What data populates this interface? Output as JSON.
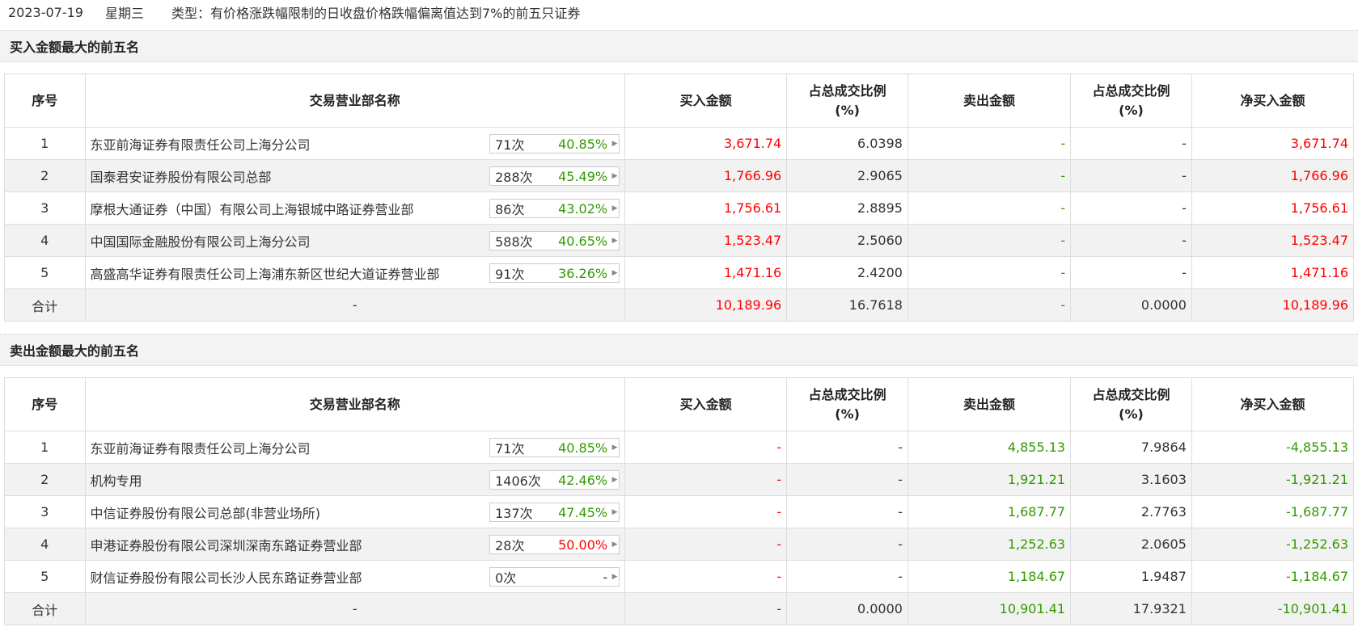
{
  "header": {
    "date": "2023-07-19",
    "weekday": "星期三",
    "type_text": "类型：有价格涨跌幅限制的日收盘价格跌幅偏离值达到7%的前五只证券"
  },
  "columns": {
    "idx": "序号",
    "name": "交易营业部名称",
    "buy": "买入金额",
    "buy_ratio_1": "占总成交比例",
    "buy_ratio_2": "(%)",
    "sell": "卖出金额",
    "sell_ratio_1": "占总成交比例",
    "sell_ratio_2": "(%)",
    "net": "净买入金额"
  },
  "colors": {
    "up": "#ff0000",
    "down": "#339900",
    "neutral": "#333333"
  },
  "buy_section": {
    "title": "买入金额最大的前五名",
    "rows": [
      {
        "idx": "1",
        "name": "东亚前海证券有限责任公司上海分公司",
        "count": "71次",
        "rate": "40.85%",
        "buy": "3,671.74",
        "buy_ratio": "6.0398",
        "sell": "-",
        "sell_ratio": "-",
        "net": "3,671.74"
      },
      {
        "idx": "2",
        "name": "国泰君安证券股份有限公司总部",
        "count": "288次",
        "rate": "45.49%",
        "buy": "1,766.96",
        "buy_ratio": "2.9065",
        "sell": "-",
        "sell_ratio": "-",
        "net": "1,766.96"
      },
      {
        "idx": "3",
        "name": "摩根大通证券（中国）有限公司上海银城中路证券营业部",
        "count": "86次",
        "rate": "43.02%",
        "buy": "1,756.61",
        "buy_ratio": "2.8895",
        "sell": "-",
        "sell_ratio": "-",
        "net": "1,756.61"
      },
      {
        "idx": "4",
        "name": "中国国际金融股份有限公司上海分公司",
        "count": "588次",
        "rate": "40.65%",
        "buy": "1,523.47",
        "buy_ratio": "2.5060",
        "sell": "-",
        "sell_ratio": "-",
        "net": "1,523.47"
      },
      {
        "idx": "5",
        "name": "高盛高华证券有限责任公司上海浦东新区世纪大道证券营业部",
        "count": "91次",
        "rate": "36.26%",
        "buy": "1,471.16",
        "buy_ratio": "2.4200",
        "sell": "-",
        "sell_ratio": "-",
        "net": "1,471.16"
      }
    ],
    "total": {
      "label": "合计",
      "name": "-",
      "buy": "10,189.96",
      "buy_ratio": "16.7618",
      "sell": "-",
      "sell_ratio": "0.0000",
      "net": "10,189.96"
    }
  },
  "sell_section": {
    "title": "卖出金额最大的前五名",
    "rows": [
      {
        "idx": "1",
        "name": "东亚前海证券有限责任公司上海分公司",
        "count": "71次",
        "rate": "40.85%",
        "buy": "-",
        "buy_ratio": "-",
        "sell": "4,855.13",
        "sell_ratio": "7.9864",
        "net": "-4,855.13"
      },
      {
        "idx": "2",
        "name": "机构专用",
        "count": "1406次",
        "rate": "42.46%",
        "buy": "-",
        "buy_ratio": "-",
        "sell": "1,921.21",
        "sell_ratio": "3.1603",
        "net": "-1,921.21"
      },
      {
        "idx": "3",
        "name": "中信证券股份有限公司总部(非营业场所)",
        "count": "137次",
        "rate": "47.45%",
        "buy": "-",
        "buy_ratio": "-",
        "sell": "1,687.77",
        "sell_ratio": "2.7763",
        "net": "-1,687.77"
      },
      {
        "idx": "4",
        "name": "申港证券股份有限公司深圳深南东路证券营业部",
        "count": "28次",
        "rate": "50.00%",
        "buy": "-",
        "buy_ratio": "-",
        "sell": "1,252.63",
        "sell_ratio": "2.0605",
        "net": "-1,252.63"
      },
      {
        "idx": "5",
        "name": "财信证券股份有限公司长沙人民东路证券营业部",
        "count": "0次",
        "rate": "-",
        "buy": "-",
        "buy_ratio": "-",
        "sell": "1,184.67",
        "sell_ratio": "1.9487",
        "net": "-1,184.67"
      }
    ],
    "total": {
      "label": "合计",
      "name": "-",
      "buy": "-",
      "buy_ratio": "0.0000",
      "sell": "10,901.41",
      "sell_ratio": "17.9321",
      "net": "-10,901.41"
    }
  }
}
